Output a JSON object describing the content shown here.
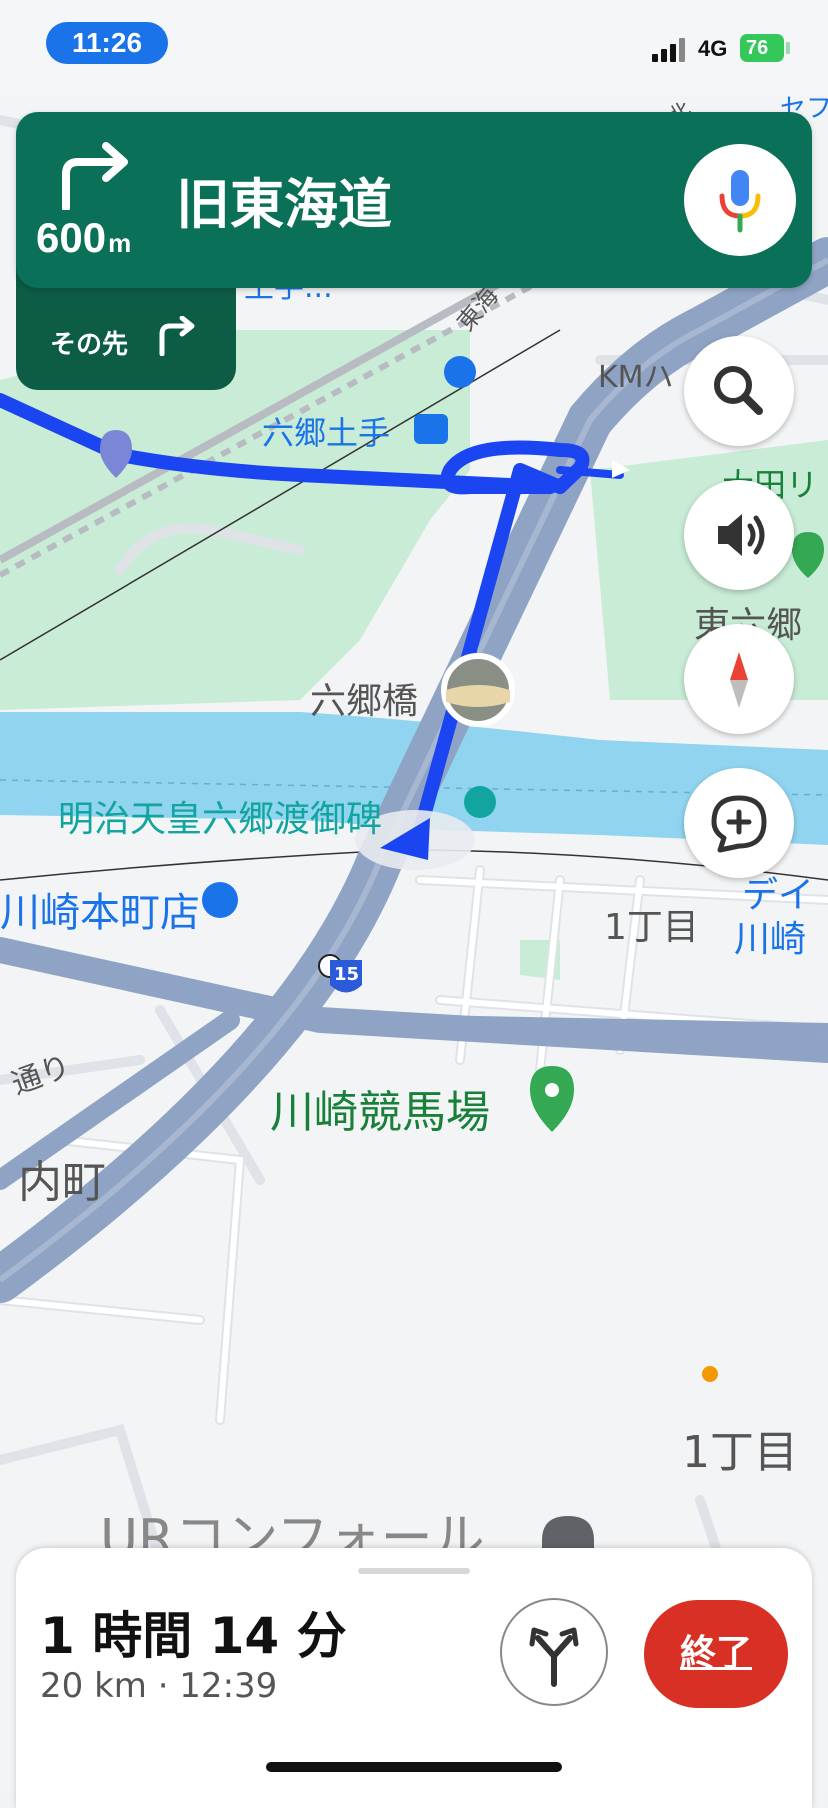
{
  "status_bar": {
    "time": "11:26",
    "network": "4G",
    "battery": "76"
  },
  "navigation": {
    "distance_value": "600",
    "distance_unit": "m",
    "street_name": "旧東海道",
    "then_label": "その先",
    "maneuver_icon": "turn-right-icon",
    "then_icon": "turn-right-icon"
  },
  "map": {
    "labels": {
      "station": "六郷土手",
      "bridge": "六郷橋",
      "monument": "明治天皇六郷渡御碑",
      "store": "川崎本町店",
      "racecourse": "川崎競馬場",
      "district_1": "1丁目",
      "district_2": "1丁目",
      "district_3": "東六郷",
      "district_4": "内町",
      "road_name": "通り",
      "apartment": "URコンフォール",
      "shop_partial": "KMハ",
      "shop_partial_2": "土手...",
      "right_partial_1": "デイ",
      "right_partial_2": "川崎",
      "right_partial_3": "大田リ",
      "route_shield": "15",
      "road_top": "東海",
      "road_top_2": "北",
      "corner": "セフ"
    },
    "colors": {
      "route": "#1a45f0",
      "river": "#8fd3ee",
      "park": "#c6ead4",
      "highway": "#8fa4c4",
      "label_green": "#188038",
      "label_teal": "#12a5a0",
      "label_blue": "#1a73e8"
    }
  },
  "controls": {
    "search_icon": "search-icon",
    "sound_icon": "volume-icon",
    "compass_icon": "compass-icon",
    "report_icon": "add-report-icon",
    "mic_icon": "microphone-icon"
  },
  "trip": {
    "duration": "1 時間 14 分",
    "details": "20 km · 12:39",
    "exit_label": "終了",
    "alt_routes_icon": "alternate-routes-icon"
  }
}
